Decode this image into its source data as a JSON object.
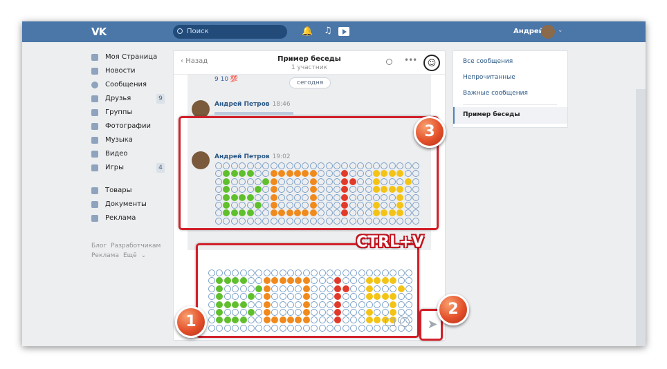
{
  "header": {
    "logo": "VK",
    "search_placeholder": "Поиск",
    "user_name": "Андрей"
  },
  "nav": {
    "main": [
      {
        "label": "Моя Страница",
        "icon": "home-icon"
      },
      {
        "label": "Новости",
        "icon": "news-icon"
      },
      {
        "label": "Сообщения",
        "icon": "messages-icon"
      },
      {
        "label": "Друзья",
        "icon": "friends-icon",
        "badge": "9"
      },
      {
        "label": "Группы",
        "icon": "groups-icon"
      },
      {
        "label": "Фотографии",
        "icon": "camera-icon"
      },
      {
        "label": "Музыка",
        "icon": "music-icon"
      },
      {
        "label": "Видео",
        "icon": "video-icon"
      },
      {
        "label": "Игры",
        "icon": "games-icon",
        "badge": "4"
      }
    ],
    "secondary": [
      {
        "label": "Товары",
        "icon": "shop-icon"
      },
      {
        "label": "Документы",
        "icon": "document-icon"
      },
      {
        "label": "Реклама",
        "icon": "ads-icon"
      }
    ],
    "footer": [
      "Блог",
      "Разработчикам",
      "Реклама",
      "Ещё"
    ]
  },
  "chat": {
    "back": "Назад",
    "title": "Пример беседы",
    "subtitle": "1 участник",
    "top_emoji": "9 10 💯",
    "date_label": "сегодня",
    "messages": [
      {
        "author": "Андрей Петров",
        "time": "18:46"
      },
      {
        "author": "Андрей Петров",
        "time": "19:02"
      }
    ]
  },
  "right_menu": {
    "items": [
      "Все сообщения",
      "Непрочитанные",
      "Важные сообщения"
    ],
    "active": "Пример беседы"
  },
  "annotations": {
    "n1": "1",
    "n2": "2",
    "n3": "3",
    "shortcut": "CTRL+V"
  },
  "colors": {
    "accent": "#4a76a8",
    "highlight": "#d1202a",
    "green": "#5fbf2d",
    "orange": "#f08a1c",
    "red": "#e23a2a",
    "yellow": "#f3c316"
  }
}
